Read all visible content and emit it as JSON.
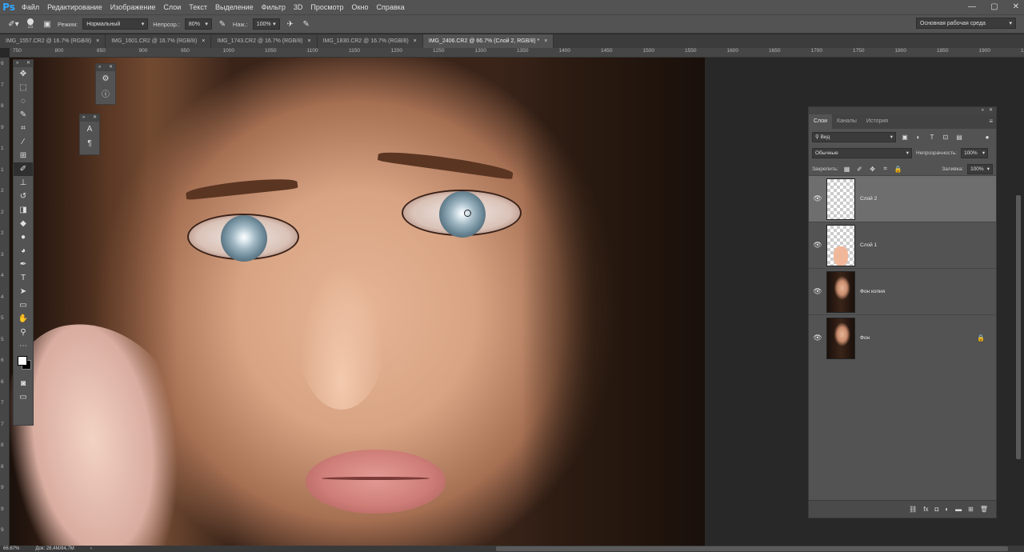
{
  "app": {
    "logo": "Ps"
  },
  "menu": [
    "Файл",
    "Редактирование",
    "Изображение",
    "Слои",
    "Текст",
    "Выделение",
    "Фильтр",
    "3D",
    "Просмотр",
    "Окно",
    "Справка"
  ],
  "window_controls": {
    "minimize": "—",
    "maximize": "▢",
    "close": "✕"
  },
  "options": {
    "brush_size": "25",
    "mode_label": "Режим:",
    "mode_value": "Нормальный",
    "opacity_label": "Непрозр.:",
    "opacity_value": "80%",
    "flow_label": "Наж.:",
    "flow_value": "100%",
    "workspace": "Основная рабочая среда"
  },
  "tabs": [
    {
      "label": "IMG_1557.CR2 @ 16.7% (RGB/8)",
      "close": "×"
    },
    {
      "label": "IMG_1601.CR2 @ 16.7% (RGB/8)",
      "close": "×"
    },
    {
      "label": "IMG_1743.CR2 @ 16.7% (RGB/8)",
      "close": "×"
    },
    {
      "label": "IMG_1830.CR2 @ 16.7% (RGB/8)",
      "close": "×"
    },
    {
      "label": "IMG_2406.CR2 @ 66.7% (Слой 2, RGB/8) *",
      "close": "×"
    }
  ],
  "ruler_top": [
    "750",
    "800",
    "850",
    "900",
    "950",
    "1000",
    "1050",
    "1100",
    "1150",
    "1200",
    "1250",
    "1300",
    "1350",
    "1400",
    "1450",
    "1500",
    "1550",
    "1600",
    "1650",
    "1700",
    "1750",
    "1800",
    "1850",
    "1900",
    "1950",
    "2000",
    "2050",
    "2100",
    "2150",
    "2200",
    "2250"
  ],
  "ruler_left": [
    "6",
    "7",
    "8",
    "9",
    "1",
    "1",
    "2",
    "2",
    "2",
    "3",
    "4",
    "4",
    "5",
    "5",
    "6",
    "6",
    "7",
    "7",
    "8",
    "8",
    "9",
    "9",
    "9"
  ],
  "tools": [
    {
      "name": "move-tool",
      "glyph": "✥"
    },
    {
      "name": "marquee-tool",
      "glyph": "⬚"
    },
    {
      "name": "lasso-tool",
      "glyph": "◌"
    },
    {
      "name": "quick-select-tool",
      "glyph": "✎"
    },
    {
      "name": "crop-tool",
      "glyph": "⌗"
    },
    {
      "name": "eyedropper-tool",
      "glyph": "⁄"
    },
    {
      "name": "frame-tool",
      "glyph": "⊞"
    },
    {
      "name": "brush-tool",
      "glyph": "✐",
      "active": true
    },
    {
      "name": "stamp-tool",
      "glyph": "⊥"
    },
    {
      "name": "history-brush-tool",
      "glyph": "↺"
    },
    {
      "name": "eraser-tool",
      "glyph": "◨"
    },
    {
      "name": "paint-bucket-tool",
      "glyph": "◆"
    },
    {
      "name": "blur-tool",
      "glyph": "●"
    },
    {
      "name": "dodge-tool",
      "glyph": "◕"
    },
    {
      "name": "pen-tool",
      "glyph": "✒"
    },
    {
      "name": "type-tool",
      "glyph": "T"
    },
    {
      "name": "path-select-tool",
      "glyph": "➤"
    },
    {
      "name": "shape-tool",
      "glyph": "▭"
    },
    {
      "name": "hand-tool",
      "glyph": "✋"
    },
    {
      "name": "zoom-tool",
      "glyph": "⚲"
    },
    {
      "name": "more-tools",
      "glyph": "⋯"
    }
  ],
  "mini_panel_1": [
    {
      "name": "adjust-icon",
      "glyph": "⚙"
    },
    {
      "name": "info-icon",
      "glyph": "ⓘ"
    }
  ],
  "mini_panel_2": [
    {
      "name": "character-icon",
      "glyph": "A"
    },
    {
      "name": "paragraph-icon",
      "glyph": "¶"
    }
  ],
  "layers_panel": {
    "tabs": [
      "Слои",
      "Каналы",
      "История"
    ],
    "filter_label": "Вид",
    "blend_mode": "Обычные",
    "opacity_label": "Непрозрачность:",
    "opacity_value": "100%",
    "lock_label": "Закрепить:",
    "fill_label": "Заливка:",
    "fill_value": "100%",
    "layers": [
      {
        "name": "Слой 2",
        "thumb": "transparent",
        "selected": true,
        "locked": false
      },
      {
        "name": "Слой 1",
        "thumb": "transparent-skin",
        "selected": false,
        "locked": false
      },
      {
        "name": "Фон копия",
        "thumb": "photo",
        "selected": false,
        "locked": false
      },
      {
        "name": "Фон",
        "thumb": "photo",
        "selected": false,
        "locked": true
      }
    ],
    "footer_icons": [
      "link-icon",
      "fx-icon",
      "mask-icon",
      "adjustment-icon",
      "folder-icon",
      "new-layer-icon",
      "trash-icon"
    ]
  },
  "status": {
    "zoom": "66.67%",
    "doc": "Док: 28,4M/84,7M",
    "arrow": "›"
  },
  "colors": {
    "accent": "#31a8ff",
    "panel": "#535353",
    "bg": "#282828"
  }
}
